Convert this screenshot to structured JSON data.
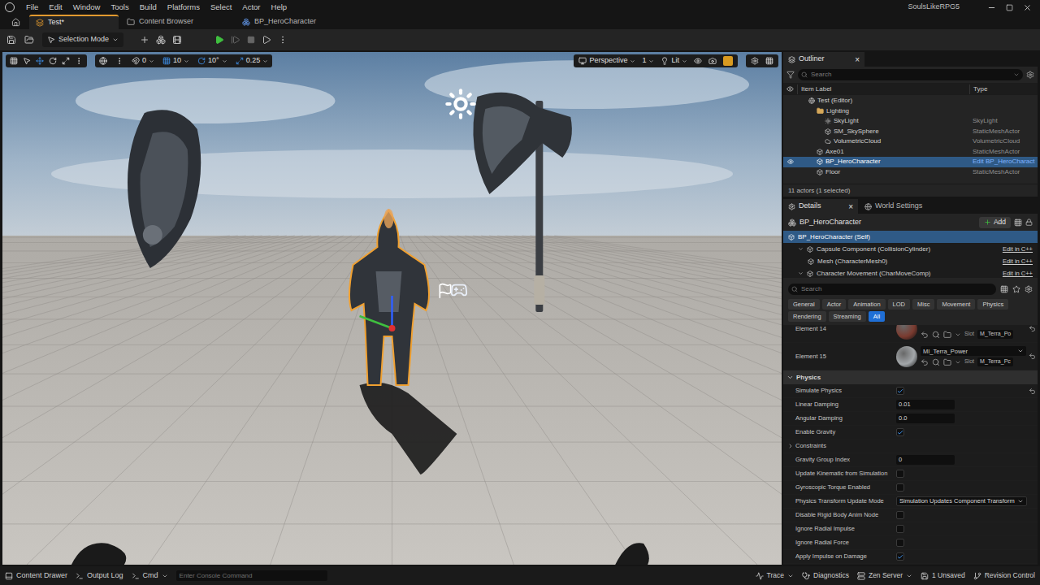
{
  "title_bar": {
    "menu": [
      "File",
      "Edit",
      "Window",
      "Tools",
      "Build",
      "Platforms",
      "Select",
      "Actor",
      "Help"
    ],
    "project": "SoulsLikeRPG5"
  },
  "tabs": [
    {
      "label": "Test*",
      "selected": true
    },
    {
      "label": "Content Browser",
      "selected": false
    },
    {
      "label": "BP_HeroCharacter",
      "selected": false
    }
  ],
  "toolbar": {
    "mode": "Selection Mode"
  },
  "viewport": {
    "snap": [
      "0",
      "10",
      "10°",
      "0.25"
    ],
    "view": "Perspective",
    "view_count": "1",
    "lighting": "Lit"
  },
  "outliner": {
    "title": "Outliner",
    "search": "Search",
    "columns": [
      "Item Label",
      "Type"
    ],
    "rows": [
      {
        "label": "Test (Editor)",
        "type": "",
        "kind": "world",
        "depth": 0,
        "selected": false,
        "type_link": false
      },
      {
        "label": "Lighting",
        "type": "",
        "kind": "folder",
        "depth": 1,
        "selected": false,
        "type_link": false
      },
      {
        "label": "SkyLight",
        "type": "SkyLight",
        "kind": "actor",
        "depth": 2,
        "selected": false,
        "type_link": false
      },
      {
        "label": "SM_SkySphere",
        "type": "StaticMeshActor",
        "kind": "actor",
        "depth": 2,
        "selected": false,
        "type_link": false
      },
      {
        "label": "VolumetricCloud",
        "type": "VolumetricCloud",
        "kind": "actor",
        "depth": 2,
        "selected": false,
        "type_link": false
      },
      {
        "label": "Axe01",
        "type": "StaticMeshActor",
        "kind": "actor",
        "depth": 1,
        "selected": false,
        "type_link": false
      },
      {
        "label": "BP_HeroCharacter",
        "type": "Edit BP_HeroCharact",
        "kind": "actor",
        "depth": 1,
        "selected": true,
        "type_link": true
      },
      {
        "label": "Floor",
        "type": "StaticMeshActor",
        "kind": "actor",
        "depth": 1,
        "selected": false,
        "type_link": false
      }
    ],
    "footer": "11 actors (1 selected)"
  },
  "details": {
    "title": "Details",
    "close": "×",
    "other_tab": "World Settings",
    "actor": "BP_HeroCharacter",
    "add": "Add",
    "components": [
      {
        "name": "BP_HeroCharacter (Self)",
        "action": "",
        "depth": 0,
        "selected": true
      },
      {
        "name": "Capsule Component (CollisionCylinder)",
        "action": "Edit in C++",
        "depth": 1,
        "selected": false
      },
      {
        "name": "Mesh (CharacterMesh0)",
        "action": "Edit in C++",
        "depth": 2,
        "selected": false
      },
      {
        "name": "Character Movement (CharMoveComp)",
        "action": "Edit in C++",
        "depth": 1,
        "selected": false
      }
    ],
    "search": "Search",
    "filters": [
      [
        {
          "label": "General",
          "selected": false
        },
        {
          "label": "Actor",
          "selected": false
        },
        {
          "label": "Animation",
          "selected": false
        },
        {
          "label": "LOD",
          "selected": false
        },
        {
          "label": "Misc",
          "selected": false
        },
        {
          "label": "Movement",
          "selected": false
        },
        {
          "label": "Physics",
          "selected": false
        }
      ],
      [
        {
          "label": "Rendering",
          "selected": false
        },
        {
          "label": "Streaming",
          "selected": false
        },
        {
          "label": "All",
          "selected": true
        }
      ]
    ],
    "properties": [
      {
        "kind": "material",
        "label": "Element 14",
        "slot_label": "Slot",
        "slot": "M_Terra_Po",
        "color": "#7a3b30",
        "modified": true
      },
      {
        "kind": "material",
        "label": "Element 15",
        "value": "MI_Terra_Power",
        "slot_label": "Slot",
        "slot": "M_Terra_Pc",
        "color": "#a3a7aa",
        "modified": true
      },
      {
        "kind": "section",
        "label": "Physics",
        "expanded": true
      },
      {
        "kind": "checkbox",
        "label": "Simulate Physics",
        "checked": true,
        "modified": true
      },
      {
        "kind": "number",
        "label": "Linear Damping",
        "value": "0.01"
      },
      {
        "kind": "number",
        "label": "Angular Damping",
        "value": "0.0"
      },
      {
        "kind": "checkbox",
        "label": "Enable Gravity",
        "checked": true
      },
      {
        "kind": "group",
        "label": "Constraints",
        "expanded": false
      },
      {
        "kind": "number",
        "label": "Gravity Group Index",
        "value": "0"
      },
      {
        "kind": "checkbox",
        "label": "Update Kinematic from Simulation",
        "checked": false
      },
      {
        "kind": "checkbox",
        "label": "Gyroscopic Torque Enabled",
        "checked": false
      },
      {
        "kind": "select",
        "label": "Physics Transform Update Mode",
        "value": "Simulation Updates Component Transform"
      },
      {
        "kind": "checkbox",
        "label": "Disable Rigid Body Anim Node",
        "checked": false
      },
      {
        "kind": "checkbox",
        "label": "Ignore Radial Impulse",
        "checked": false
      },
      {
        "kind": "checkbox",
        "label": "Ignore Radial Force",
        "checked": false
      },
      {
        "kind": "checkbox",
        "label": "Apply Impulse on Damage",
        "checked": true
      }
    ]
  },
  "status_bar": {
    "content_drawer": "Content Drawer",
    "output_log": "Output Log",
    "cmd": "Cmd",
    "console_placeholder": "Enter Console Command",
    "right": [
      "Trace",
      "Diagnostics",
      "Zen Server",
      "1 Unsaved",
      "Revision Control"
    ]
  }
}
